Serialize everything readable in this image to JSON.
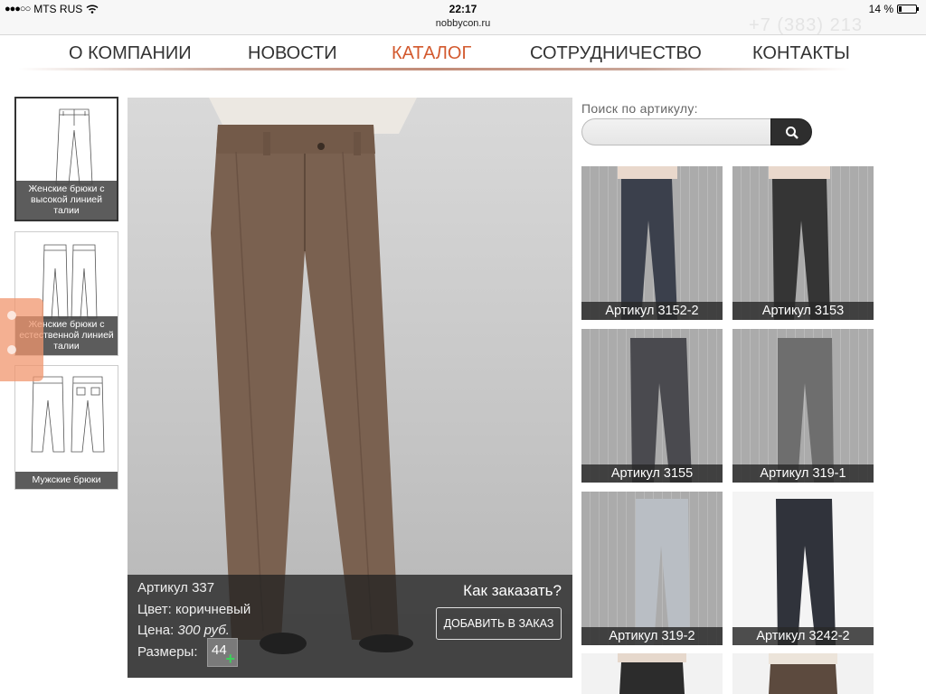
{
  "statusbar": {
    "carrier": "MTS RUS",
    "time": "22:17",
    "battery": "14 %",
    "url": "nobbycon.ru",
    "phone_ghost": "+7 (383) 213"
  },
  "nav": {
    "items": [
      {
        "label": "О компании"
      },
      {
        "label": "Новости"
      },
      {
        "label": "Каталог"
      },
      {
        "label": "Сотрудничество"
      },
      {
        "label": "Контакты"
      }
    ],
    "active_color": "#d35a2f"
  },
  "categories": [
    {
      "caption": "Женские брюки с высокой линией талии"
    },
    {
      "caption": "Женские брюки с естественной линией талии"
    },
    {
      "caption": "Мужские брюки"
    }
  ],
  "product": {
    "article": "Артикул 337",
    "color_line": "Цвет: коричневый",
    "price_prefix": "Цена: ",
    "price_value": "300 руб.",
    "sizes_label": "Размеры:",
    "size": "44",
    "how_to_order": "Как заказать?",
    "add_button": "Добавить в заказ"
  },
  "search": {
    "label": "Поиск по артикулу:",
    "placeholder": "",
    "button_icon": "search-icon"
  },
  "grid": [
    {
      "label": "Артикул 3152-2",
      "color": "#3b404c"
    },
    {
      "label": "Артикул 3153",
      "color": "#353535"
    },
    {
      "label": "Артикул 3155",
      "color": "#4a4a4f"
    },
    {
      "label": "Артикул 319-1",
      "color": "#6e6e6e"
    },
    {
      "label": "Артикул 319-2",
      "color": "#b9bec4"
    },
    {
      "label": "Артикул 3242-2",
      "color": "#30333b"
    },
    {
      "label": "",
      "color": "#2c2c2c"
    },
    {
      "label": "",
      "color": "#5c4a3e"
    }
  ]
}
